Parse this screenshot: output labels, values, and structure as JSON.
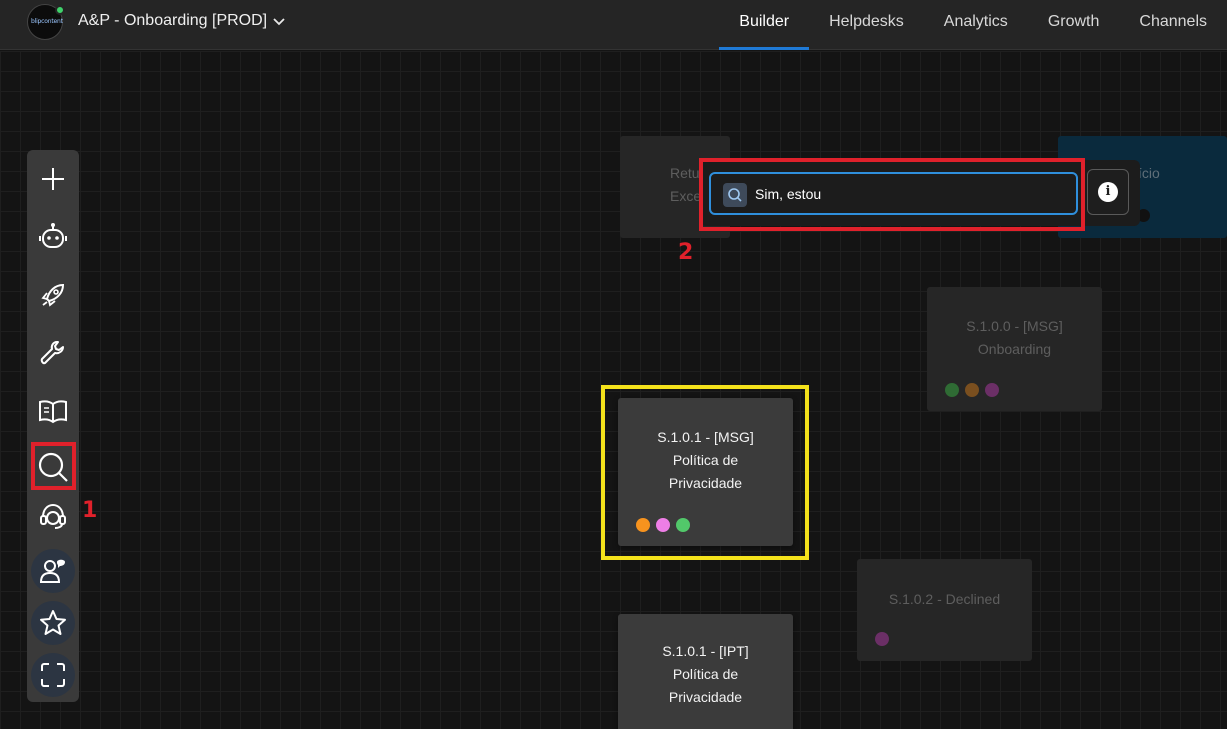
{
  "header": {
    "logo_text": "blipcontent",
    "bot_title": "A&P - Onboarding [PROD]",
    "nav_tabs": [
      {
        "label": "Builder",
        "active": true
      },
      {
        "label": "Helpdesks",
        "active": false
      },
      {
        "label": "Analytics",
        "active": false
      },
      {
        "label": "Growth",
        "active": false
      },
      {
        "label": "Channels",
        "active": false
      }
    ]
  },
  "sidebar": {
    "items": [
      {
        "name": "add",
        "icon": "plus-icon"
      },
      {
        "name": "bot",
        "icon": "robot-icon"
      },
      {
        "name": "launch",
        "icon": "rocket-icon"
      },
      {
        "name": "tools",
        "icon": "wrench-icon"
      },
      {
        "name": "docs",
        "icon": "book-icon"
      },
      {
        "name": "search",
        "icon": "search-icon"
      },
      {
        "name": "support",
        "icon": "headset-icon"
      },
      {
        "name": "users",
        "icon": "user-chat-icon"
      },
      {
        "name": "favorites",
        "icon": "star-icon"
      },
      {
        "name": "fullscreen",
        "icon": "expand-icon"
      }
    ]
  },
  "search": {
    "value": "Sim, estou",
    "info_label": "i"
  },
  "annotations": {
    "one": "1",
    "two": "2"
  },
  "blocks": {
    "retu": {
      "line1": "Retu",
      "line2": "Exce"
    },
    "inicio": {
      "line1": "ício"
    },
    "onboarding": {
      "line1": "S.1.0.0 - [MSG]",
      "line2": "Onboarding"
    },
    "msg_politica": {
      "line1": "S.1.0.1 - [MSG]",
      "line2": "Política de",
      "line3": "Privacidade"
    },
    "declined": {
      "line1": "S.1.0.2 - Declined"
    },
    "ipt_politica": {
      "line1": "S.1.0.1 - [IPT]",
      "line2": "Política de",
      "line3": "Privacidade"
    }
  },
  "colors": {
    "accent": "#1f7ad6",
    "highlight_red": "#e0212b",
    "highlight_yellow": "#f4e21b",
    "dot_orange": "#f7931e",
    "dot_pink": "#ee7ee6",
    "dot_green": "#52c86a",
    "dot_green_dim": "#2f6b34",
    "dot_orange_dim": "#7a4f1f",
    "dot_purple_dim": "#6b2f66"
  }
}
